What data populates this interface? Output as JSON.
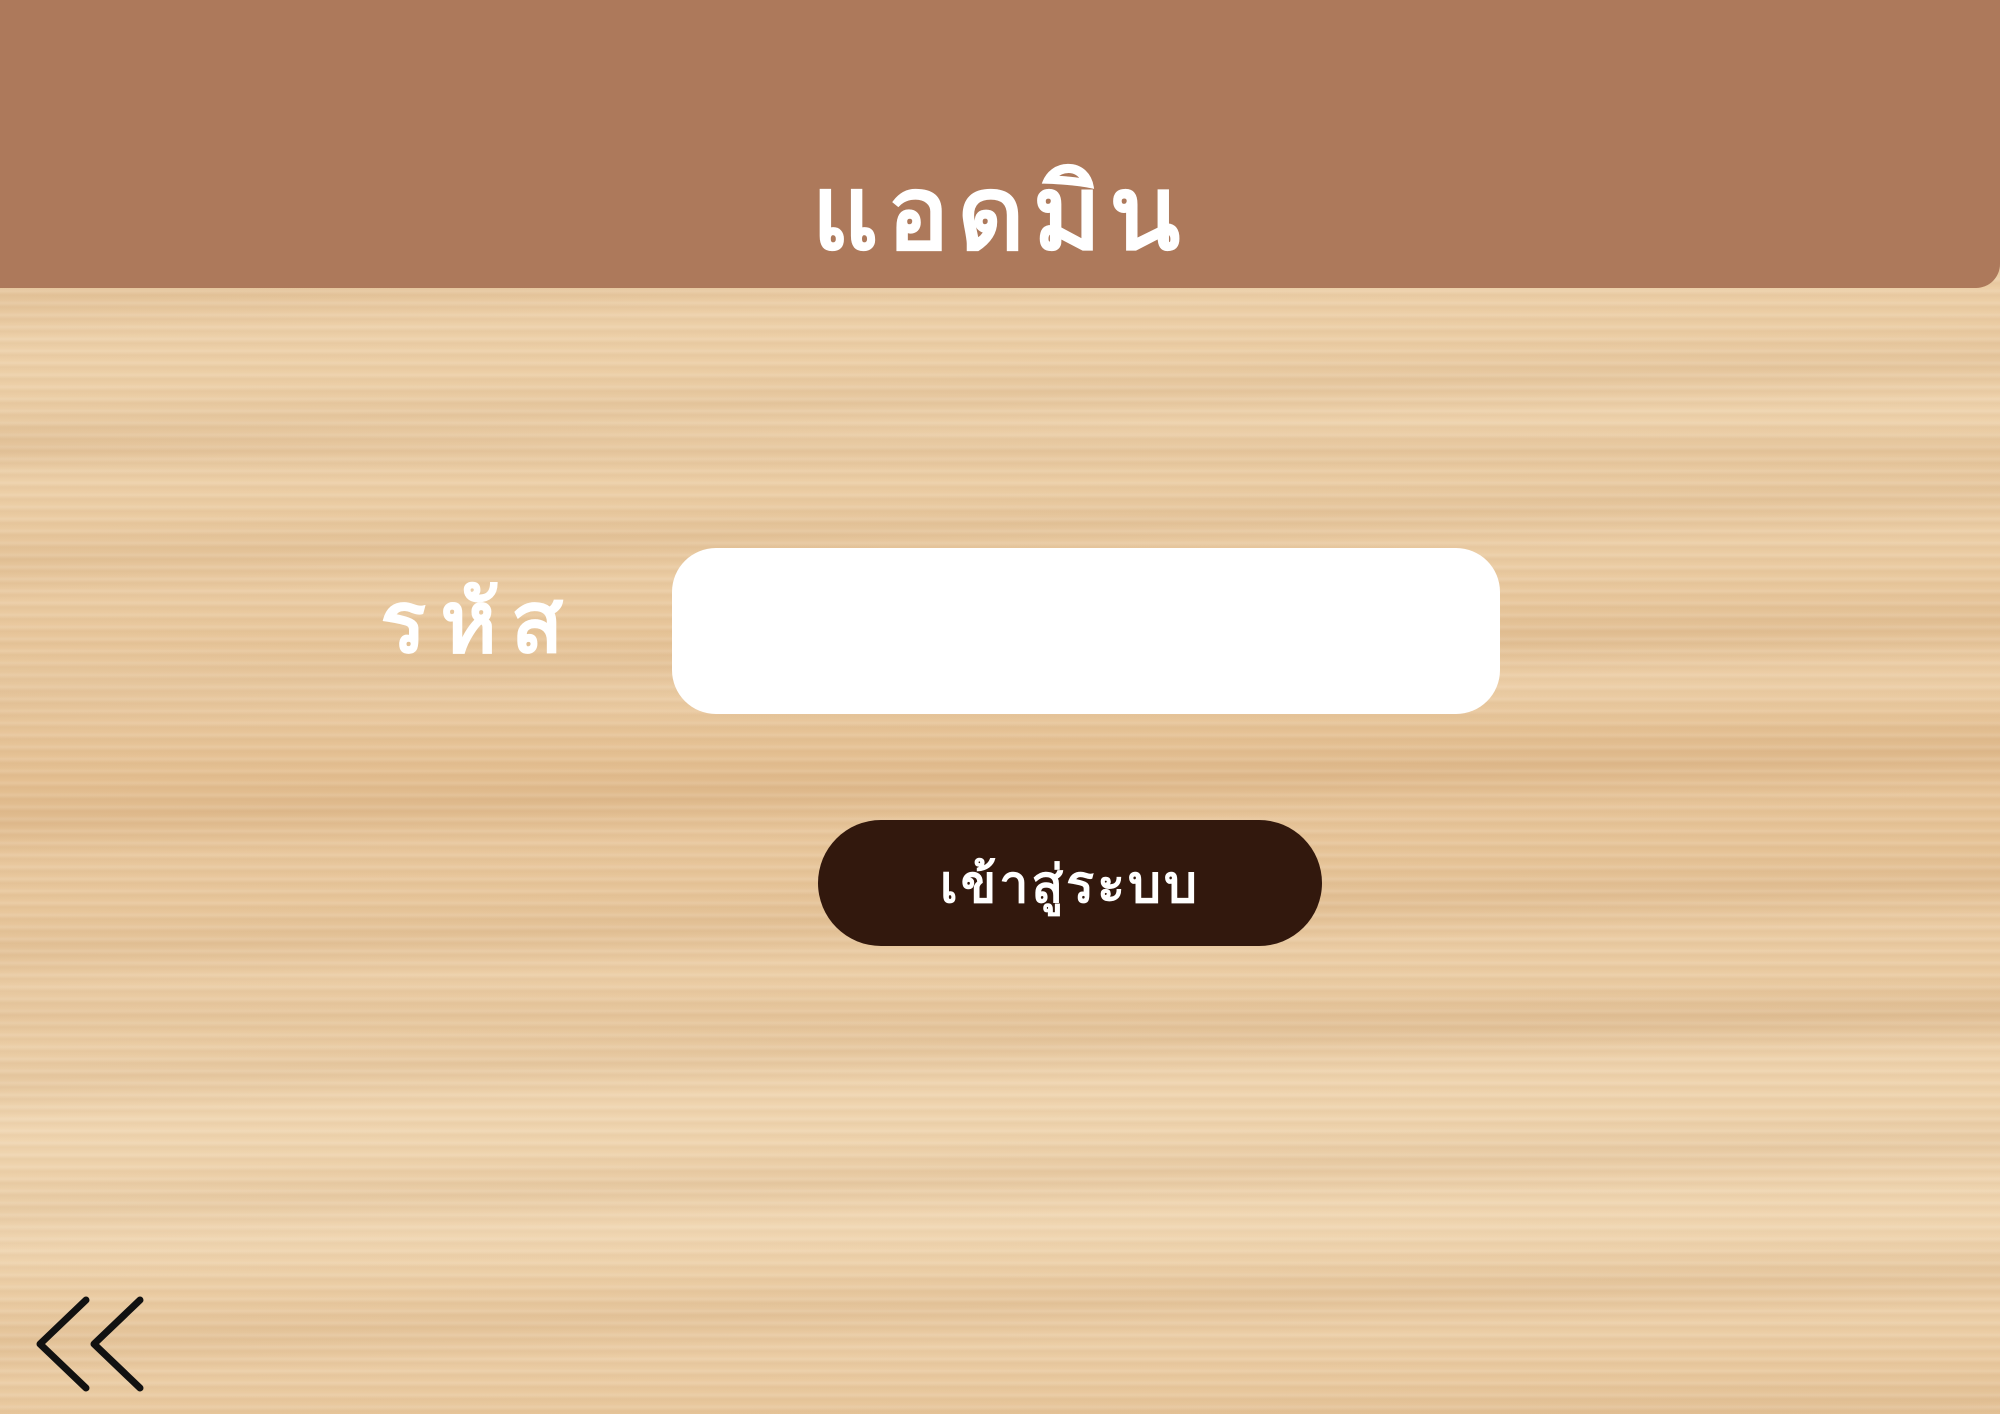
{
  "header": {
    "title": "แอดมิน",
    "color": "#ad795b"
  },
  "form": {
    "code_label": "รหัส",
    "code_value": "",
    "login_label": "เข้าสู่ระบบ",
    "login_color": "#32180d"
  },
  "navigation": {
    "back_icon": "double-chevron-left-icon"
  },
  "theme": {
    "background": "wood-texture",
    "text_color": "#ffffff"
  }
}
